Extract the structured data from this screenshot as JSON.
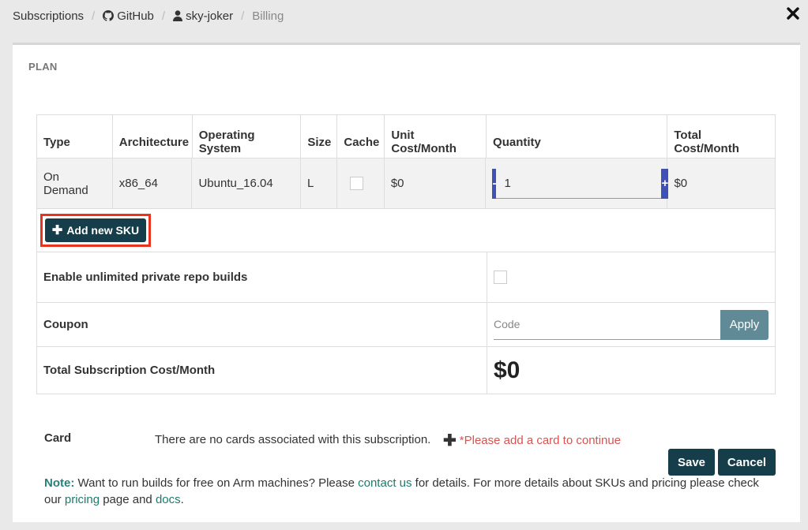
{
  "breadcrumb": {
    "items": [
      {
        "label": "Subscriptions"
      },
      {
        "label": "GitHub"
      },
      {
        "label": "sky-joker"
      },
      {
        "label": "Billing"
      }
    ],
    "separator": "/"
  },
  "icons": {
    "github": "github-icon",
    "user": "user-icon",
    "close": "close-icon",
    "plus": "plus-icon"
  },
  "plan": {
    "heading": "PLAN",
    "table": {
      "headers": [
        "Type",
        "Architecture",
        "Operating System",
        "Size",
        "Cache",
        "Unit Cost/Month",
        "Quantity",
        "Total Cost/Month"
      ],
      "row": {
        "type": "On Demand",
        "architecture": "x86_64",
        "os": "Ubuntu_16.04",
        "size": "L",
        "cache_checked": false,
        "unit_cost": "$0",
        "quantity": "1",
        "total_cost": "$0",
        "minus_label": "-",
        "plus_label": "+"
      }
    },
    "add_sku_label": "Add new SKU",
    "unlimited_label": "Enable unlimited private repo builds",
    "unlimited_checked": false,
    "coupon": {
      "label": "Coupon",
      "placeholder": "Code",
      "apply_label": "Apply"
    },
    "total": {
      "label": "Total Subscription Cost/Month",
      "value": "$0"
    }
  },
  "card": {
    "label": "Card",
    "message": "There are no cards associated with this subscription.",
    "add_prompt": "*Please add a card to continue"
  },
  "actions": {
    "save_label": "Save",
    "cancel_label": "Cancel"
  },
  "note": {
    "prefix": "Note:",
    "text1": " Want to run builds for free on Arm machines? Please ",
    "link1": "contact us",
    "text2": " for details. For more details about SKUs and pricing please check our ",
    "link2": "pricing",
    "text3": " page and ",
    "link3": "docs",
    "text4": "."
  },
  "colors": {
    "primary_dark": "#153d4a",
    "stepper": "#3f51b5",
    "apply": "#5f8a96",
    "warning": "#d9534f",
    "highlight": "#e8341f",
    "link": "#1e7a6e"
  }
}
